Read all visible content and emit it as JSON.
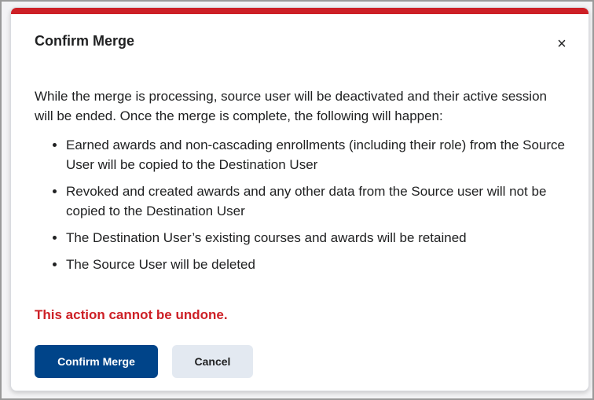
{
  "dialog": {
    "title": "Confirm Merge",
    "close_label": "×",
    "intro": "While the merge is processing, source user will be deactivated and their active session will be ended. Once the merge is complete, the following will happen:",
    "bullets": [
      "Earned awards and non-cascading enrollments (including their role) from the Source User will be copied to the Destination User",
      "Revoked and created awards and any other data from the Source user will not be copied to the Destination User",
      "The Destination User’s existing courses and awards will be retained",
      "The Source User will be deleted"
    ],
    "warning": "This action cannot be undone.",
    "confirm_label": "Confirm Merge",
    "cancel_label": "Cancel"
  },
  "colors": {
    "accent": "#cd2026",
    "primary": "#004489",
    "secondary": "#e3e9f1"
  }
}
